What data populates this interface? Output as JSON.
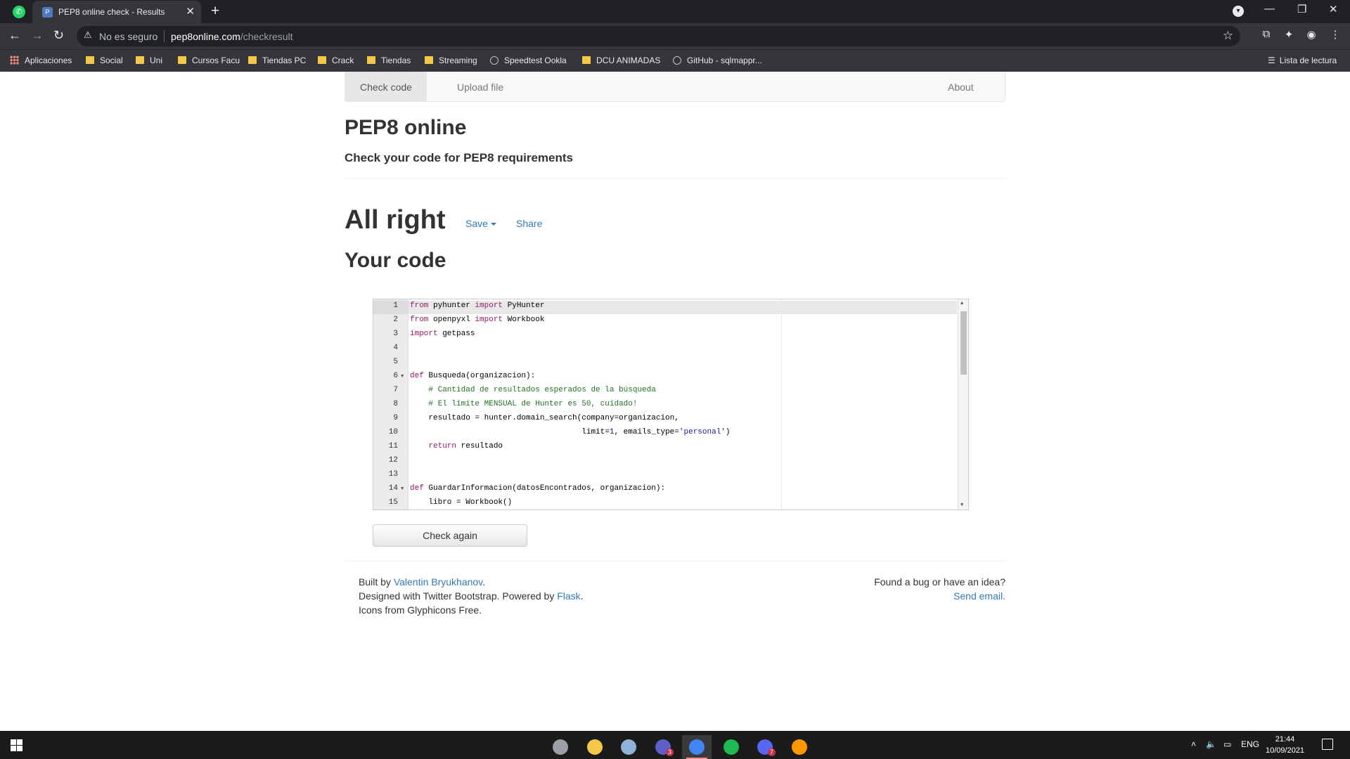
{
  "browser": {
    "tab_title": "PEP8 online check - Results",
    "security_label": "No es seguro",
    "url_host": "pep8online.com",
    "url_path": "/checkresult",
    "bookmarks": [
      {
        "label": "Aplicaciones",
        "icon": "apps-grid-icon"
      },
      {
        "label": "Social",
        "icon": "folder-icon"
      },
      {
        "label": "Uni",
        "icon": "folder-icon"
      },
      {
        "label": "Cursos Facu",
        "icon": "folder-icon"
      },
      {
        "label": "Tiendas PC",
        "icon": "folder-icon"
      },
      {
        "label": "Crack",
        "icon": "folder-icon"
      },
      {
        "label": "Tiendas",
        "icon": "folder-icon"
      },
      {
        "label": "Streaming",
        "icon": "folder-icon"
      },
      {
        "label": "Speedtest Ookla",
        "icon": "speedtest-icon"
      },
      {
        "label": "DCU ANIMADAS",
        "icon": "folder-icon"
      },
      {
        "label": "GitHub - sqlmappr...",
        "icon": "github-icon"
      }
    ],
    "reading_list": "Lista de lectura"
  },
  "site": {
    "nav": {
      "check_code": "Check code",
      "upload_file": "Upload file",
      "about": "About"
    },
    "title": "PEP8 online",
    "subtitle": "Check your code for PEP8 requirements",
    "result_heading": "All right",
    "save_label": "Save",
    "share_label": "Share",
    "your_code_heading": "Your code",
    "check_again_label": "Check again",
    "footer": {
      "built_by_prefix": "Built by ",
      "author": "Valentin Bryukhanov",
      "built_by_suffix": ".",
      "designed_prefix": "Designed with Twitter Bootstrap. Powered by ",
      "flask": "Flask",
      "designed_suffix": ".",
      "icons_credit": "Icons from Glyphicons Free.",
      "bug_prompt": "Found a bug or have an idea?",
      "send_email": "Send email."
    }
  },
  "code": {
    "lines": [
      {
        "n": "1",
        "tokens": [
          {
            "t": "from",
            "c": "kw"
          },
          {
            "t": " pyhunter "
          },
          {
            "t": "import",
            "c": "kw"
          },
          {
            "t": " PyHunter"
          }
        ]
      },
      {
        "n": "2",
        "tokens": [
          {
            "t": "from",
            "c": "kw"
          },
          {
            "t": " openpyxl "
          },
          {
            "t": "import",
            "c": "kw"
          },
          {
            "t": " Workbook"
          }
        ]
      },
      {
        "n": "3",
        "tokens": [
          {
            "t": "import",
            "c": "kw"
          },
          {
            "t": " getpass"
          }
        ]
      },
      {
        "n": "4",
        "tokens": []
      },
      {
        "n": "5",
        "tokens": []
      },
      {
        "n": "6",
        "fold": true,
        "tokens": [
          {
            "t": "def",
            "c": "kw"
          },
          {
            "t": " Busqueda(organizacion):"
          }
        ]
      },
      {
        "n": "7",
        "tokens": [
          {
            "t": "    "
          },
          {
            "t": "# Cantidad de resultados esperados de la búsqueda",
            "c": "cm"
          }
        ]
      },
      {
        "n": "8",
        "tokens": [
          {
            "t": "    "
          },
          {
            "t": "# El límite MENSUAL de Hunter es 50, cuidado!",
            "c": "cm"
          }
        ]
      },
      {
        "n": "9",
        "tokens": [
          {
            "t": "    resultado = hunter.domain_search(company=organizacion,"
          }
        ]
      },
      {
        "n": "10",
        "tokens": [
          {
            "t": "                                     limit="
          },
          {
            "t": "1",
            "c": "st"
          },
          {
            "t": ", emails_type="
          },
          {
            "t": "'personal'",
            "c": "st"
          },
          {
            "t": ")"
          }
        ]
      },
      {
        "n": "11",
        "tokens": [
          {
            "t": "    "
          },
          {
            "t": "return",
            "c": "kw"
          },
          {
            "t": " resultado"
          }
        ]
      },
      {
        "n": "12",
        "tokens": []
      },
      {
        "n": "13",
        "tokens": []
      },
      {
        "n": "14",
        "fold": true,
        "tokens": [
          {
            "t": "def",
            "c": "kw"
          },
          {
            "t": " GuardarInformacion(datosEncontrados, organizacion):"
          }
        ]
      },
      {
        "n": "15",
        "tokens": [
          {
            "t": "    libro = Workbook()"
          }
        ]
      }
    ]
  },
  "taskbar": {
    "apps": [
      {
        "name": "feather-app-icon",
        "color": "#9aa0a6"
      },
      {
        "name": "file-explorer-icon",
        "color": "#f6c84a"
      },
      {
        "name": "notes-app-icon",
        "color": "#8fb3d9"
      },
      {
        "name": "teams-icon",
        "color": "#5b5fc7",
        "badge": "3"
      },
      {
        "name": "chrome-icon",
        "color": "#4285f4",
        "active": true
      },
      {
        "name": "spotify-icon",
        "color": "#1db954"
      },
      {
        "name": "discord-icon",
        "color": "#5865f2",
        "badge": "7"
      },
      {
        "name": "sublime-text-icon",
        "color": "#ff9800"
      }
    ],
    "language": "ENG",
    "time": "21:44",
    "date": "10/09/2021"
  }
}
